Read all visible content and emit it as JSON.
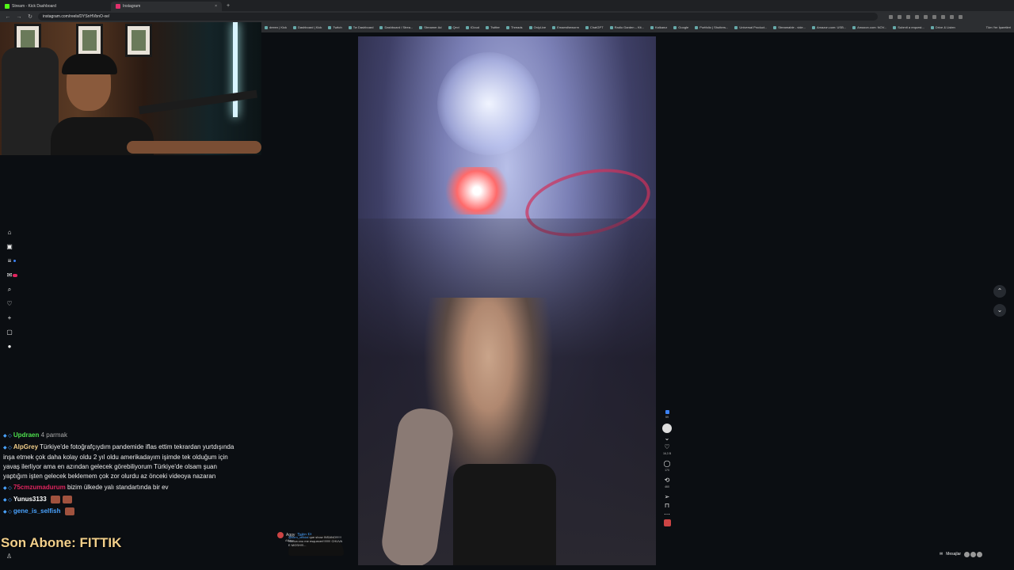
{
  "browser": {
    "tabs": [
      {
        "label": "Stream - Kick Dashboard",
        "fav_color": "#53fc18",
        "active": false
      },
      {
        "label": "Instagram",
        "fav_color": "#e1306c",
        "active": true
      }
    ],
    "url": "instagram.com/reels/DYSnHVbnO-xe/",
    "bookmarks": [
      "deeen | Kick",
      "Dashboard | Kick",
      "Twitch",
      "Tw Dashboard",
      "Dashboard / Strea...",
      "Streamer Ad",
      "Qevi",
      "iCloud",
      "Twitter",
      "Threads",
      "OnlyLive",
      "Emaestheworm",
      "ChatGPT",
      "Radio Garden – Kit...",
      "Kalkanız",
      "Google",
      "Portfolio | Shutters...",
      "Universal Product...",
      "Streamable - vide...",
      "Amazon.com: USB...",
      "Amazon.com: NOV...",
      "Submit a request...",
      "Drive & Listen"
    ],
    "bookmarks_all": "Tüm Yer İşaretleri"
  },
  "sidebar": {
    "icons": [
      "home-icon",
      "reels-icon",
      "menu-icon",
      "notifications-icon",
      "search-icon",
      "heart-icon",
      "create-icon",
      "activity-icon",
      "profile-icon"
    ]
  },
  "post": {
    "username": "Aggy",
    "follow": "Takip Et",
    "location": "Allianz Parque - São Paulo, Brazil",
    "caption_user": "@korn_official",
    "caption": "que show INSANO!!!!!! Nunca vou me esquecer!!!!!!!!! CHUVA E MOSH!!!..."
  },
  "actions": {
    "reel_count": "59",
    "likes": "16,3 B",
    "comments": "170",
    "reposts": "460"
  },
  "messages": {
    "label": "Mesajlar"
  },
  "chat": [
    {
      "nick": "Updraen",
      "color": "#4ee04e",
      "text": "4 parmak",
      "text_color": "#aaa",
      "emotes": 0
    },
    {
      "nick": "AlpGrey",
      "color": "#f2cf8a",
      "text": "Türkiye'de fotoğrafçıydım pandemide iflas ettim tekrardan yurtdışında inşa etmek çok daha kolay oldu 2 yıl oldu amerikadayım işimde tek olduğum için yavaş ilerliyor ama en azından gelecek görebiliyorum Türkiye'de olsam şuan yaptığım işten gelecek beklemem çok zor olurdu az önceki videoya nazaran",
      "text_color": "#eee",
      "emotes": 0
    },
    {
      "nick": "75cmzumadurum",
      "color": "#e0245e",
      "text": "bizim ülkede yalı standartında bir ev",
      "text_color": "#eee",
      "emotes": 0
    },
    {
      "nick": "Yunus3133",
      "color": "#ffffff",
      "text": "",
      "text_color": "#eee",
      "emotes": 2
    },
    {
      "nick": "gene_is_selfish",
      "color": "#4aa3ff",
      "text": "",
      "text_color": "#eee",
      "emotes": 1
    }
  ],
  "overlay": {
    "last_sub": "Son Abone: FITTIK"
  }
}
